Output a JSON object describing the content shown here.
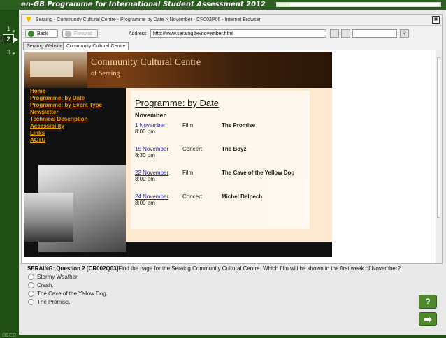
{
  "app": {
    "title": "en-GB Programme for International Student Assessment 2012",
    "progress": 0.08
  },
  "steps": [
    "1",
    "2",
    "3"
  ],
  "browser": {
    "window_title": "Seraing - Community Cultural Centre - Programme by Date > November - CR002P06 - Internet Browser",
    "close_glyph": "▣",
    "back_label": "Back",
    "forward_label": "Forward",
    "address_label": "Address",
    "address_value": "http://www.seraing.be/november.html",
    "tabs": [
      "Seraing Website",
      "Community Cultural Centre"
    ]
  },
  "site": {
    "header_title": "Community Cultural Centre",
    "header_sub": "of Seraing",
    "menu": [
      "Home",
      "Programme: by Date",
      "Programme: by Event Type",
      "Newsletter",
      "Technical Description",
      "Accessibility",
      "Links",
      "ACTU"
    ],
    "page_title": "Programme: by Date",
    "month": "November",
    "events": [
      {
        "date": "1 November",
        "time": "8:00 pm",
        "kind": "Film",
        "name": "The Promise"
      },
      {
        "date": "15 November",
        "time": "8:30 pm",
        "kind": "Concert",
        "name": "The Boyz"
      },
      {
        "date": "22 November",
        "time": "8:00 pm",
        "kind": "Film",
        "name": "The Cave of the Yellow Dog"
      },
      {
        "date": "24 November",
        "time": "8:00 pm",
        "kind": "Concert",
        "name": "Michel Delpech"
      }
    ]
  },
  "question": {
    "label": "SERAING: Question 2 [CR002Q03]",
    "text": "Find the page for the Seraing Community Cultural Centre. Which film will be shown in the first week of November?",
    "options": [
      "Stormy Weather.",
      "Crash.",
      "The Cave of the Yellow Dog.",
      "The Promise."
    ]
  },
  "buttons": {
    "help": "?",
    "next": "➡"
  },
  "colors": {
    "frame": "#1f4f14",
    "accent": "#4e8a2a",
    "menu_link": "#f0a000"
  }
}
